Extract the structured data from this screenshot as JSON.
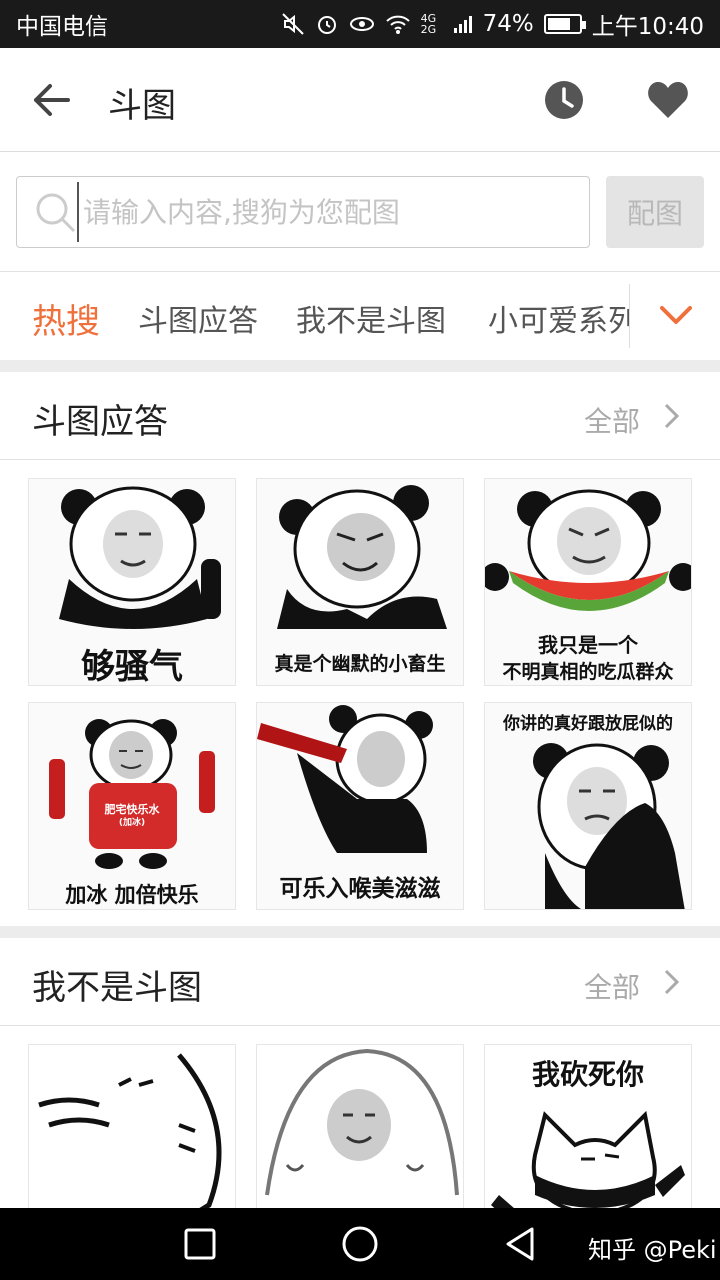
{
  "status_bar": {
    "carrier": "中国电信",
    "network": "4G 2G",
    "battery_level": 0.74,
    "battery_text": "74%",
    "time": "上午10:40",
    "icons": [
      "mute-icon",
      "alarm-icon",
      "eye-icon",
      "wifi-icon",
      "signal-icon",
      "battery-icon"
    ]
  },
  "header": {
    "title": "斗图",
    "icons": [
      "back-arrow-icon",
      "history-clock-icon",
      "favorite-heart-icon"
    ]
  },
  "search": {
    "placeholder": "请输入内容,搜狗为您配图",
    "value": "",
    "button_label": "配图"
  },
  "tabs": {
    "items": [
      {
        "label": "热搜",
        "active": true
      },
      {
        "label": "斗图应答",
        "active": false
      },
      {
        "label": "我不是斗图",
        "active": false
      },
      {
        "label": "小可爱系列",
        "active": false
      }
    ],
    "accent_color": "#f0703c"
  },
  "sections": [
    {
      "title": "斗图应答",
      "more_label": "全部",
      "stickers": [
        {
          "caption": "够骚气"
        },
        {
          "caption": "真是个幽默的小畜生"
        },
        {
          "caption": "我只是一个",
          "caption2": "不明真相的吃瓜群众"
        },
        {
          "caption": "加冰  加倍快乐",
          "shirt_text": "肥宅快乐水",
          "shirt_text2": "(加冰)"
        },
        {
          "caption": "可乐入喉美滋滋"
        },
        {
          "caption": "你讲的真好跟放屁似的"
        }
      ]
    },
    {
      "title": "我不是斗图",
      "more_label": "全部",
      "stickers": [
        {
          "caption": ""
        },
        {
          "caption": ""
        },
        {
          "caption": "我砍死你"
        }
      ]
    }
  ],
  "nav_bar": {
    "icons": [
      "recent-apps-square-icon",
      "home-circle-icon",
      "back-triangle-icon"
    ],
    "watermark": "知乎 @Peki"
  }
}
